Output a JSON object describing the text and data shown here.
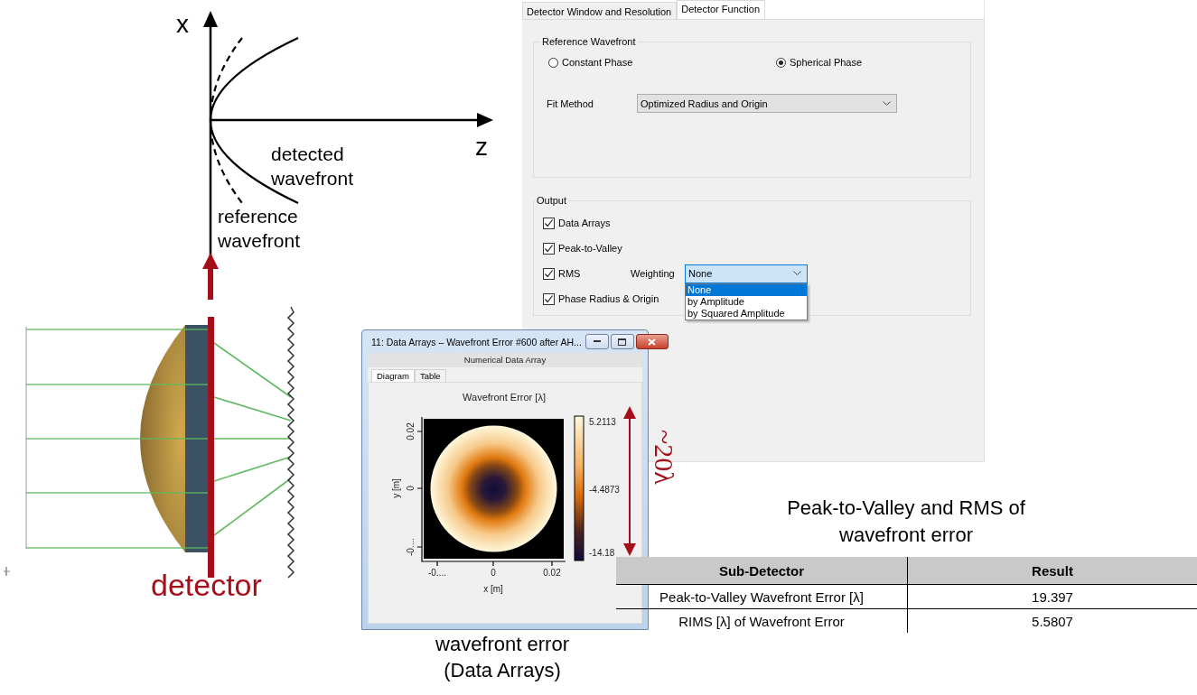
{
  "axes_diagram": {
    "x_axis_label": "x",
    "z_axis_label": "z",
    "detected_label": "detected wavefront",
    "reference_label": "reference wavefront"
  },
  "detector_label": "detector",
  "dialog": {
    "tabs": [
      {
        "label": "Detector Window and Resolution",
        "selected": false
      },
      {
        "label": "Detector Function",
        "selected": true
      }
    ],
    "reference_group": {
      "title": "Reference Wavefront",
      "options": [
        {
          "label": "Constant Phase",
          "selected": false
        },
        {
          "label": "Spherical Phase",
          "selected": true
        }
      ],
      "fit_method": {
        "label": "Fit Method",
        "value": "Optimized Radius and Origin"
      }
    },
    "output_group": {
      "title": "Output",
      "items": [
        {
          "label": "Data Arrays",
          "checked": true
        },
        {
          "label": "Peak-to-Valley",
          "checked": true
        },
        {
          "label": "RMS",
          "checked": true,
          "weighting": {
            "label": "Weighting",
            "value": "None",
            "options": [
              {
                "label": "None",
                "selected": true
              },
              {
                "label": "by Amplitude",
                "selected": false
              },
              {
                "label": "by Squared Amplitude",
                "selected": false
              }
            ]
          }
        },
        {
          "label": "Phase Radius & Origin",
          "checked": true
        }
      ]
    }
  },
  "data_window": {
    "title": "11: Data Arrays – Wavefront Error #600 after AH...",
    "header": "Numerical Data Array",
    "tabs": [
      {
        "label": "Diagram",
        "selected": true
      },
      {
        "label": "Table",
        "selected": false
      }
    ],
    "plot": {
      "title": "Wavefront Error [λ]",
      "xlabel": "x [m]",
      "ylabel": "y [m]",
      "x_ticks": [
        "-0....",
        "0",
        "0.02"
      ],
      "y_ticks": [
        "0.02",
        "0",
        "-0...."
      ],
      "colorbar_labels": [
        "5.2113",
        "-4.4873",
        "-14.18"
      ]
    }
  },
  "range_annotation": "~20λ",
  "caption": [
    "wavefront error",
    "(Data Arrays)"
  ],
  "results": {
    "title": "Peak-to-Valley and RMS of wavefront error",
    "columns": [
      "Sub-Detector",
      "Result"
    ],
    "rows": [
      [
        "Peak-to-Valley  Wavefront Error [λ]",
        "19.397"
      ],
      [
        "RIMS [λ] of Wavefront Error",
        "5.5807"
      ]
    ]
  }
}
